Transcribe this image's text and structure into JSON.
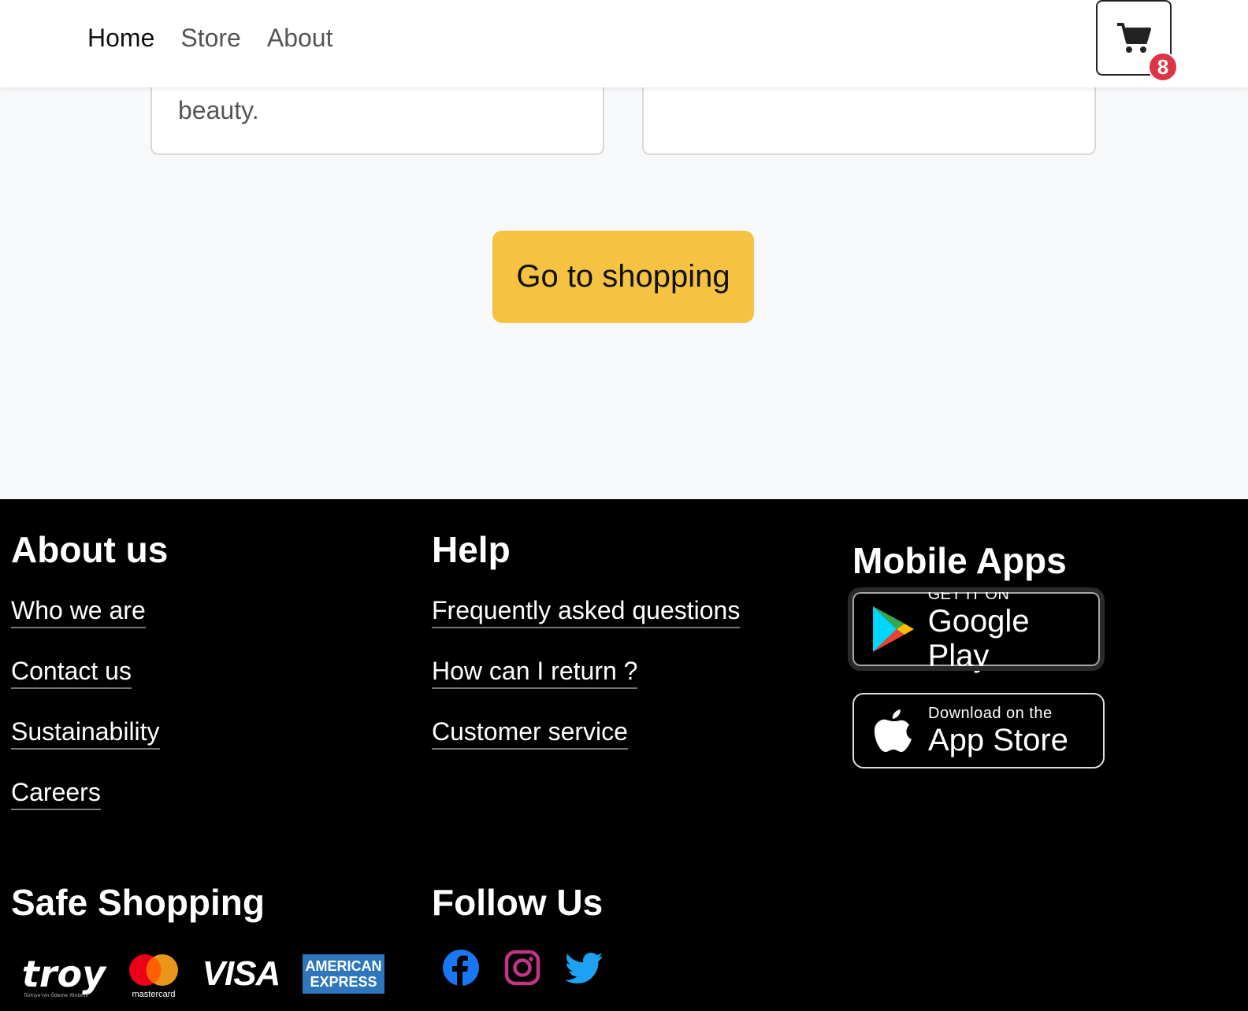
{
  "nav": {
    "links": [
      "Home",
      "Store",
      "About"
    ],
    "cart_count": "8"
  },
  "cards": {
    "left_text": "beauty."
  },
  "cta": {
    "label": "Go to shopping"
  },
  "footer": {
    "about": {
      "heading": "About us",
      "links": [
        "Who we are",
        "Contact us",
        "Sustainability",
        "Careers"
      ]
    },
    "help": {
      "heading": "Help",
      "links": [
        "Frequently asked questions",
        "How can I return ?",
        "Customer service"
      ]
    },
    "apps": {
      "heading": "Mobile Apps",
      "google_small": "GET IT ON",
      "google_big": "Google Play",
      "apple_small": "Download on the",
      "apple_big": "App Store"
    },
    "safe": {
      "heading": "Safe Shopping",
      "troy": "troy",
      "troy_sub": "Türkiye'nin Ödeme Yöntemi",
      "mastercard": "mastercard",
      "visa": "VISA",
      "amex_line1": "AMERICAN",
      "amex_line2": "EXPRESS"
    },
    "follow": {
      "heading": "Follow Us"
    }
  },
  "colors": {
    "cta": "#f5c242",
    "badge": "#dc3545",
    "facebook": "#1877f2",
    "instagram": "#c13584",
    "twitter": "#1da1f2",
    "amex": "#2e77bc"
  },
  "icons": [
    "cart-icon",
    "google-play-icon",
    "apple-icon",
    "facebook-icon",
    "instagram-icon",
    "twitter-icon"
  ]
}
